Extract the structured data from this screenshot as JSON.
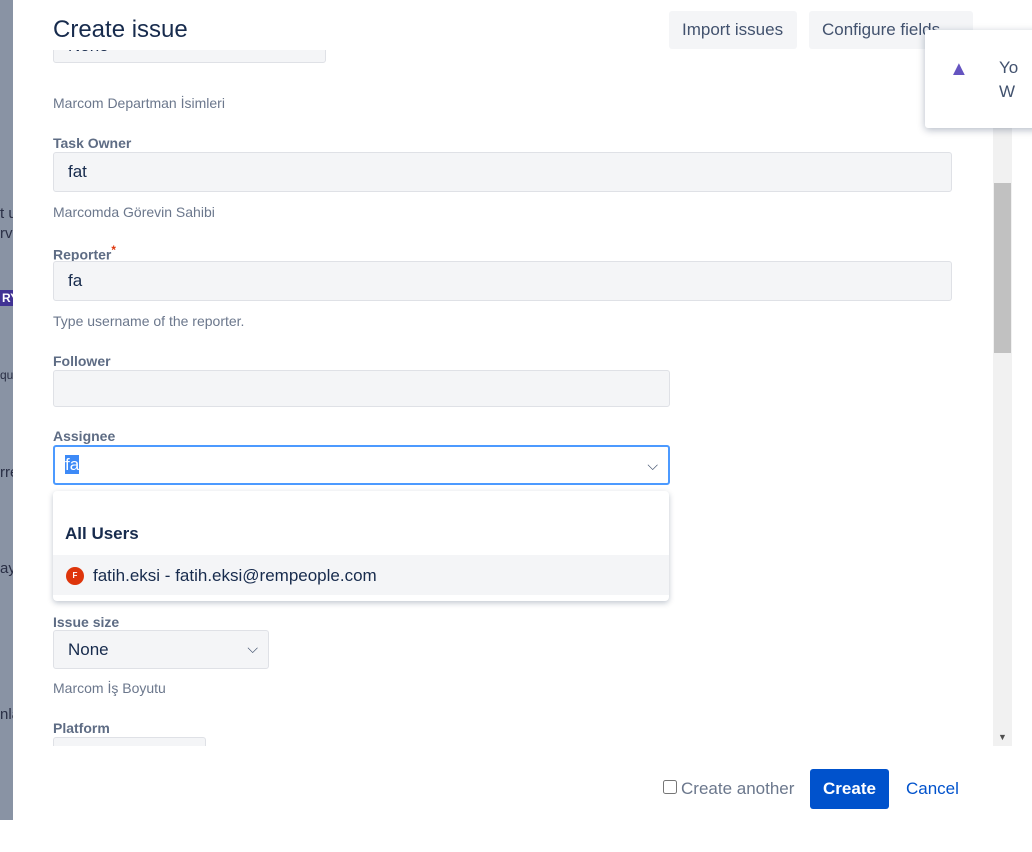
{
  "background": {
    "fragments": [
      "t u",
      "rvi",
      "RY",
      "qu",
      "rre",
      "ay",
      "nla"
    ]
  },
  "dialog": {
    "title": "Create issue",
    "import_label": "Import issues",
    "configure_label": "Configure fields",
    "department": {
      "value": "None",
      "help": "Marcom Departman İsimleri"
    },
    "task_owner": {
      "label": "Task Owner",
      "value": "fat",
      "help": "Marcomda Görevin Sahibi"
    },
    "reporter": {
      "label": "Reporter",
      "required": "*",
      "value": "fa",
      "help": "Type username of the reporter."
    },
    "follower": {
      "label": "Follower",
      "value": ""
    },
    "assignee": {
      "label": "Assignee",
      "value": "fa",
      "dropdown": {
        "header": "All Users",
        "options": [
          {
            "avatar": "F",
            "label": "fatih.eksi - fatih.eksi@rempeople.com"
          }
        ]
      }
    },
    "issue_size": {
      "label": "Issue size",
      "value": "None",
      "help": "Marcom İş Boyutu"
    },
    "platform": {
      "label": "Platform"
    },
    "footer": {
      "create_another": "Create another",
      "create": "Create",
      "cancel": "Cancel"
    }
  },
  "toast": {
    "icon": "warning-icon",
    "line1": "Yo",
    "line2": "W"
  },
  "colors": {
    "primary": "#0052cc",
    "focus": "#4c9aff",
    "warning": "#6554c0",
    "avatar": "#de350b"
  }
}
